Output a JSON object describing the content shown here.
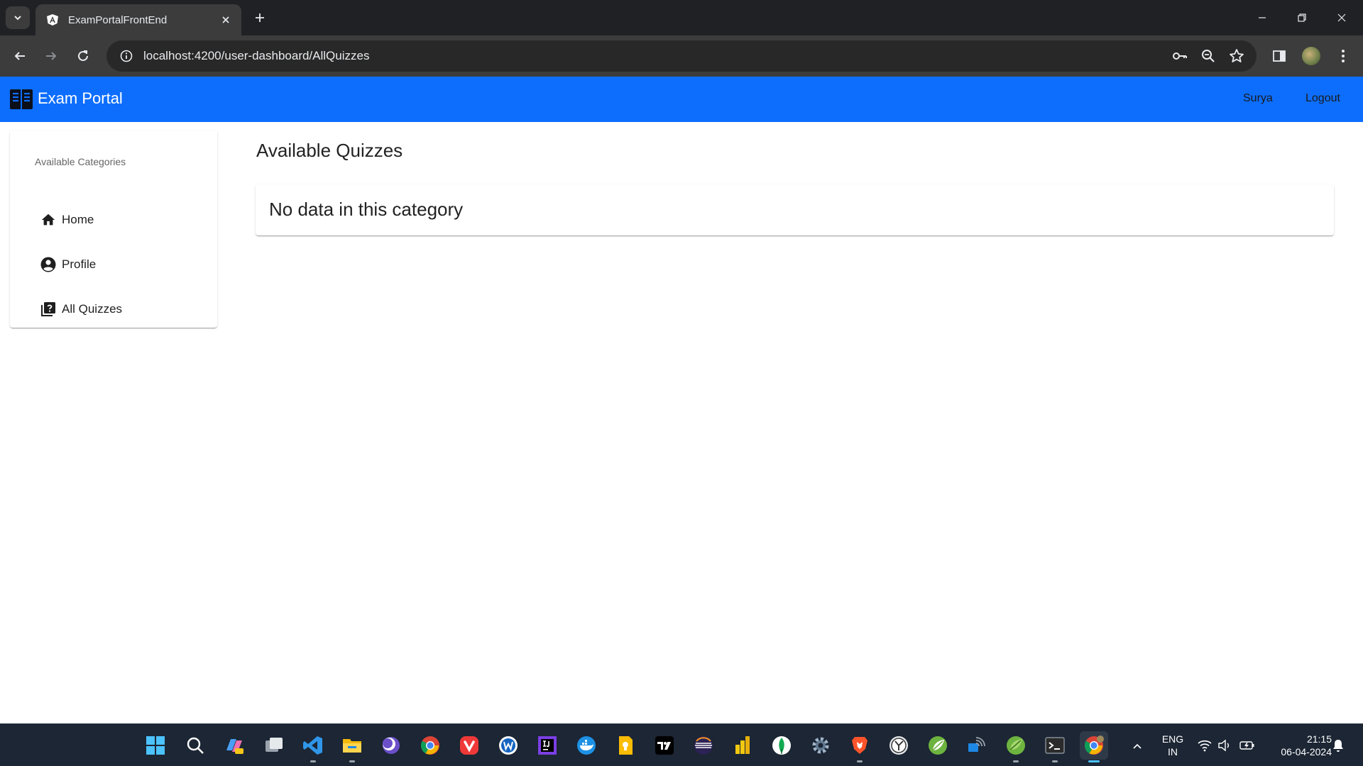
{
  "browser": {
    "tab_title": "ExamPortalFrontEnd",
    "url": "localhost:4200/user-dashboard/AllQuizzes"
  },
  "navbar": {
    "brand": "Exam Portal",
    "user_link": "Surya",
    "logout_link": "Logout",
    "color": "#0d6efd"
  },
  "sidebar": {
    "header": "Available Categories",
    "items": [
      {
        "label": "Home",
        "icon": "home-icon"
      },
      {
        "label": "Profile",
        "icon": "account-circle-icon"
      },
      {
        "label": "All Quizzes",
        "icon": "quiz-icon"
      }
    ]
  },
  "main": {
    "title": "Available Quizzes",
    "empty_message": "No data in this category"
  },
  "taskbar": {
    "language_line1": "ENG",
    "language_line2": "IN",
    "time": "21:15",
    "date": "06-04-2024"
  }
}
